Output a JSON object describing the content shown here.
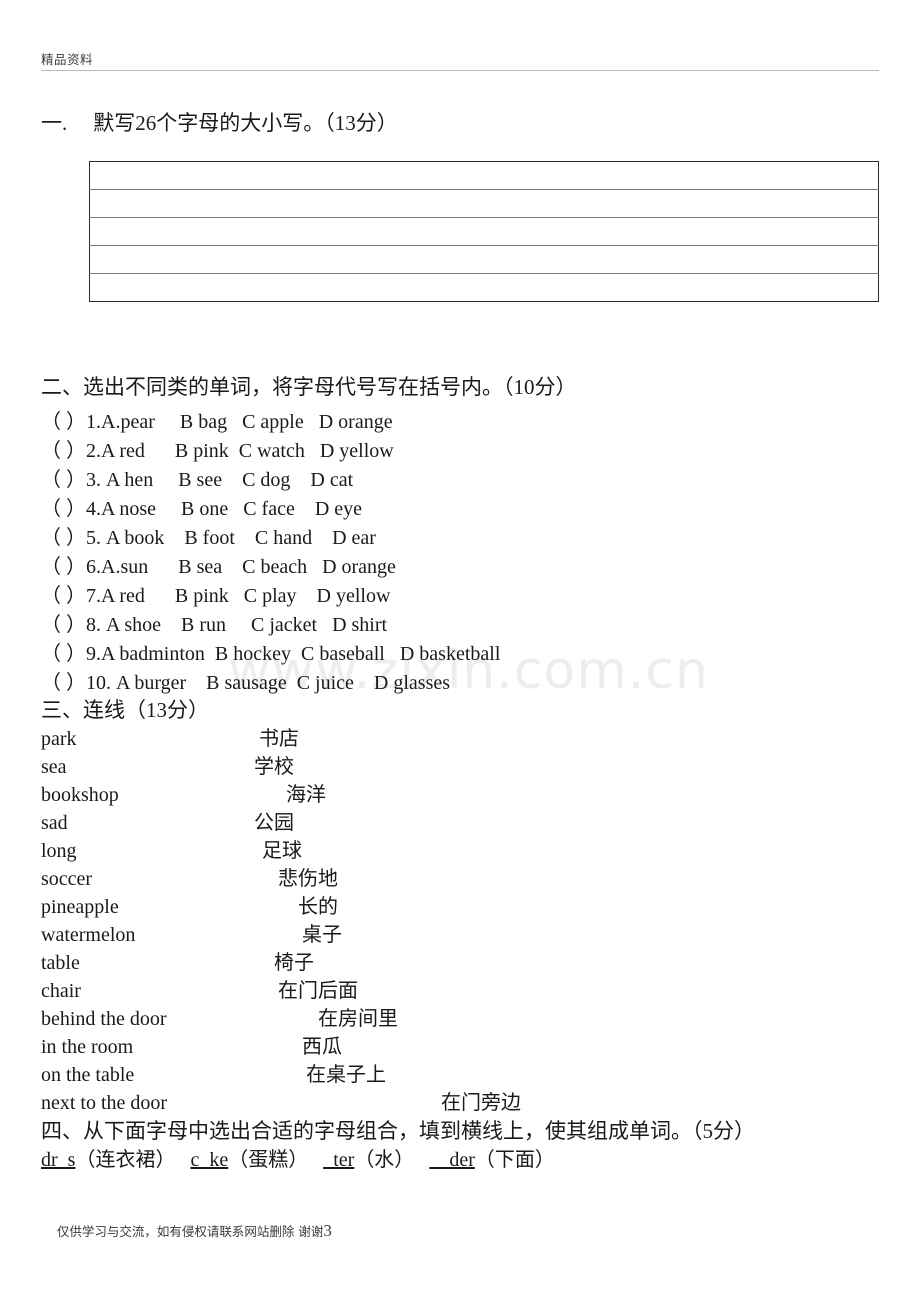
{
  "header": {
    "text": "精品资料"
  },
  "watermark": {
    "text": "www.zixin.com.cn"
  },
  "section1": {
    "number": "一.",
    "title": "默写26个字母的大小写。（13分）",
    "rows": [
      "",
      "",
      "",
      "",
      ""
    ]
  },
  "section2": {
    "heading": "二、选出不同类的单词，将字母代号写在括号内。（10分）",
    "questions": [
      "（ ）1.A.pear     B bag   C apple   D orange",
      "（ ）2.A red      B pink  C watch   D yellow",
      "（ ）3. A hen     B see    C dog    D cat",
      "（ ）4.A nose     B one   C face    D eye",
      "（ ）5. A book    B foot    C hand    D ear",
      "（ ）6.A.sun      B sea    C beach   D orange",
      "（ ）7.A red      B pink   C play    D yellow",
      "（ ）8. A shoe    B run     C jacket   D shirt",
      "（ ）9.A badminton  B hockey  C baseball   D basketball",
      "（ ）10. A burger    B sausage  C juice    D glasses"
    ]
  },
  "section3": {
    "heading": "三、连线（13分）",
    "pairs": [
      {
        "english": "park",
        "chinese": "书店",
        "indent": 218
      },
      {
        "english": "sea",
        "chinese": "学校",
        "indent": 213
      },
      {
        "english": "bookshop",
        "chinese": "海洋",
        "indent": 245
      },
      {
        "english": "sad",
        "chinese": "公园",
        "indent": 213
      },
      {
        "english": "long",
        "chinese": "足球",
        "indent": 221
      },
      {
        "english": "soccer",
        "chinese": "悲伤地",
        "indent": 237
      },
      {
        "english": "pineapple",
        "chinese": "长的",
        "indent": 257
      },
      {
        "english": "watermelon",
        "chinese": "桌子",
        "indent": 261
      },
      {
        "english": "table",
        "chinese": "椅子",
        "indent": 233
      },
      {
        "english": "chair",
        "chinese": "在门后面",
        "indent": 237
      },
      {
        "english": "behind the door",
        "chinese": "在房间里",
        "indent": 277
      },
      {
        "english": "in the room",
        "chinese": "西瓜",
        "indent": 261
      },
      {
        "english": "on the table",
        "chinese": "在桌子上",
        "indent": 265
      },
      {
        "english": "next to the door",
        "chinese": "在门旁边",
        "indent": 400
      }
    ]
  },
  "section4": {
    "heading": "四、从下面字母中选出合适的字母组合，填到横线上，使其组成单词。（5分）",
    "blanks": [
      {
        "word": "dr  s",
        "hint": "（连衣裙）"
      },
      {
        "word": "c_ke",
        "hint": "（蛋糕）"
      },
      {
        "word": "_ter",
        "hint": "（水）"
      },
      {
        "word": "__der",
        "hint": "（下面）"
      }
    ]
  },
  "footer": {
    "text": "仅供学习与交流，如有侵权请联系网站删除 谢谢",
    "page_number": "3"
  }
}
